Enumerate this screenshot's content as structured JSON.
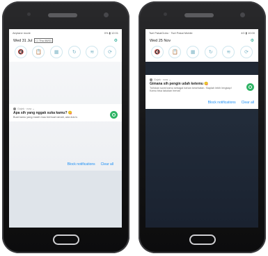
{
  "left": {
    "status_left": "Airplane mode",
    "status_right": "0% ▮ 12:01",
    "date": "Wed 31 Jul",
    "date_sub": "☐ Thu 08/01",
    "notification": {
      "app": "Gojek · now ⌄",
      "title": "Apa sih yang nggak suka kamu? 😋",
      "text": "Buat kamu yang masih mau berbuat ramah, ada dulu's",
      "block_label": "Block notifications",
      "clear_label": "Clear all"
    }
  },
  "right": {
    "status_left": "Tsel PakaiGobo · Tsel Pakai Mobile",
    "status_right": "4G ▮ 10:00",
    "date": "Wed 25 Nov",
    "notification": {
      "app": "Gojek · now ⌄",
      "title": "Gimana sih pengin udah ketemu 😋",
      "text": "Tuliskan surat kamu sebagai bahan kesehatan. Siaplah lebih lengkap! Kamu bisa lakukan hemat",
      "block_label": "Block notifications",
      "clear_label": "Clear all"
    }
  },
  "quick_settings_icons": [
    "mute-icon",
    "clipboard-icon",
    "grid-icon",
    "sync-icon",
    "wifi-icon",
    "rotate-icon"
  ],
  "quick_settings_glyphs": [
    "🔇",
    "📋",
    "▦",
    "↻",
    "≋",
    "⟳"
  ],
  "colors": {
    "accent": "#1a8ef5",
    "green": "#2fb465",
    "teal": "#1aa38c"
  }
}
